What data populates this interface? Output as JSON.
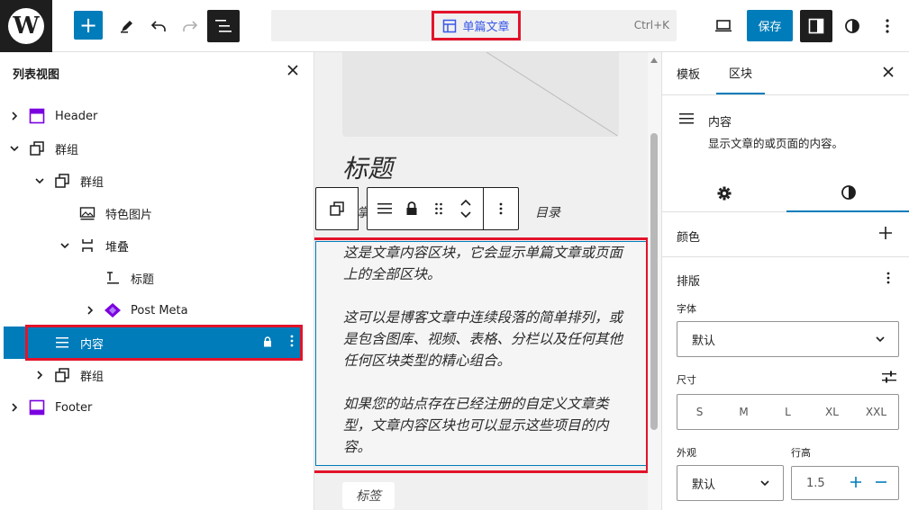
{
  "topbar": {
    "add_label": "+",
    "doc_title": "单篇文章",
    "shortcut": "Ctrl+K",
    "save_label": "保存"
  },
  "list_view": {
    "title": "列表视图",
    "items": [
      {
        "label": "Header",
        "icon": "template-part-header-icon",
        "expanded": false
      },
      {
        "label": "群组",
        "icon": "group-icon",
        "expanded": true
      },
      {
        "label": "群组",
        "icon": "group-icon",
        "expanded": true
      },
      {
        "label": "特色图片",
        "icon": "featured-image-icon"
      },
      {
        "label": "堆叠",
        "icon": "stack-icon",
        "expanded": true
      },
      {
        "label": "标题",
        "icon": "post-title-icon"
      },
      {
        "label": "Post Meta",
        "icon": "pattern-diamond-icon",
        "expanded": false
      },
      {
        "label": "内容",
        "icon": "post-content-icon",
        "selected": true,
        "locked": true
      },
      {
        "label": "群组",
        "icon": "group-icon",
        "expanded": false
      },
      {
        "label": "Footer",
        "icon": "template-part-footer-icon",
        "expanded": false
      }
    ]
  },
  "canvas": {
    "post_title": "标题",
    "meta_partial_left": "掌",
    "meta_partial_right": "目录",
    "paragraphs": [
      "这是文章内容区块，它会显示单篇文章或页面上的全部区块。",
      "这可以是博客文章中连续段落的简单排列，或是包含图库、视频、表格、分栏以及任何其他任何区块类型的精心组合。",
      "如果您的站点存在已经注册的自定义文章类型，文章内容区块也可以显示这些项目的内容。"
    ],
    "tag_chip": "标签"
  },
  "settings": {
    "tabs": [
      "模板",
      "区块"
    ],
    "active_tab": "区块",
    "block_name": "内容",
    "block_description": "显示文章的或页面的内容。",
    "color_section": "颜色",
    "typography_section": "排版",
    "font_label": "字体",
    "font_value": "默认",
    "size_label": "尺寸",
    "sizes": [
      "S",
      "M",
      "L",
      "XL",
      "XXL"
    ],
    "appearance_label": "外观",
    "appearance_value": "默认",
    "line_height_label": "行高",
    "line_height_value": "1.5"
  },
  "colors": {
    "accent": "#007cba",
    "highlight_outline": "#e3132a",
    "template_purple": "#3858e9"
  }
}
